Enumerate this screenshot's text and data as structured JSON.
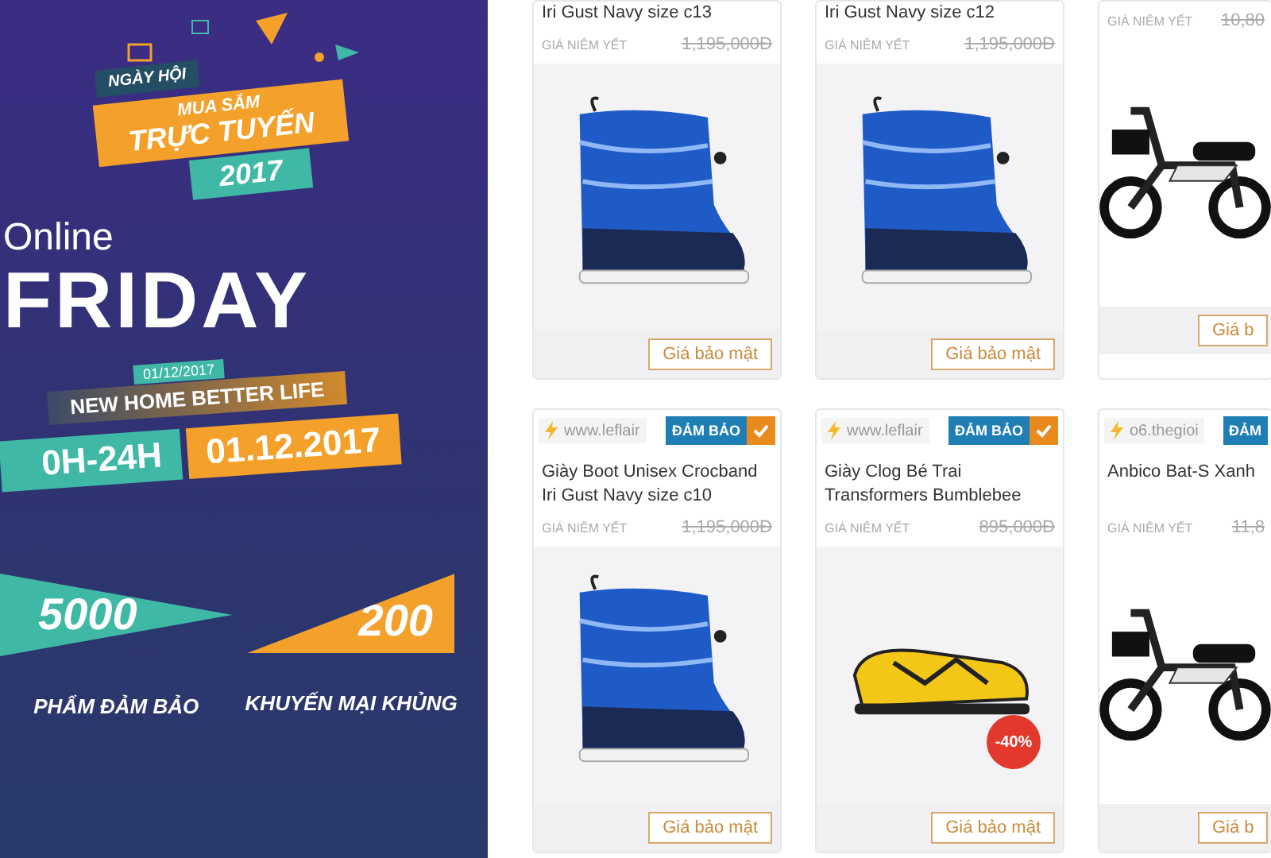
{
  "banner": {
    "event": "NGÀY HỘI",
    "line1": "MUA SẮM",
    "line2": "TRỰC TUYẾN",
    "year": "2017",
    "online": "Online",
    "friday": "FRIDAY",
    "date_small": "01/12/2017",
    "slogan": "NEW HOME BETTER LIFE",
    "hours": "0H-24H",
    "date_big": "01.12.2017",
    "stats": [
      {
        "number": "5000",
        "caption": "PHẨM ĐẢM BẢO",
        "color": "#3fb8a6"
      },
      {
        "number": "200",
        "caption": "KHUYẾN MẠI KHỦNG",
        "color": "#f3a12b"
      }
    ]
  },
  "rows": [
    [
      {
        "title": "Iri Gust Navy size c13",
        "list_label": "GIÁ NIÊM YẾT",
        "list_price": "1,195,000Đ",
        "kind": "boot",
        "button": "Giá bảo mật"
      },
      {
        "title": "Iri Gust Navy size c12",
        "list_label": "GIÁ NIÊM YẾT",
        "list_price": "1,195,000Đ",
        "kind": "boot",
        "button": "Giá bảo mật"
      },
      {
        "list_label": "GIÁ NIÊM YẾT",
        "list_price": "10,80",
        "kind": "scooter",
        "button": "Giá b"
      }
    ],
    [
      {
        "source": "www.leflair",
        "badge": "ĐẢM BẢO",
        "title": "Giày Boot Unisex Crocband Iri Gust Navy size c10",
        "list_label": "GIÁ NIÊM YẾT",
        "list_price": "1,195,000Đ",
        "kind": "boot",
        "button": "Giá bảo mật"
      },
      {
        "source": "www.leflair",
        "badge": "ĐẢM BẢO",
        "title": "Giày Clog Bé Trai Transformers Bumblebee",
        "list_label": "GIÁ NIÊM YẾT",
        "list_price": "895,000Đ",
        "kind": "clog",
        "discount": "-40%",
        "button": "Giá bảo mật"
      },
      {
        "source": "o6.thegioi",
        "badge": "ĐẢM",
        "title": "Anbico Bat-S Xanh",
        "list_label": "GIÁ NIÊM YẾT",
        "list_price": "11,8",
        "kind": "scooter",
        "button": "Giá b"
      }
    ]
  ]
}
